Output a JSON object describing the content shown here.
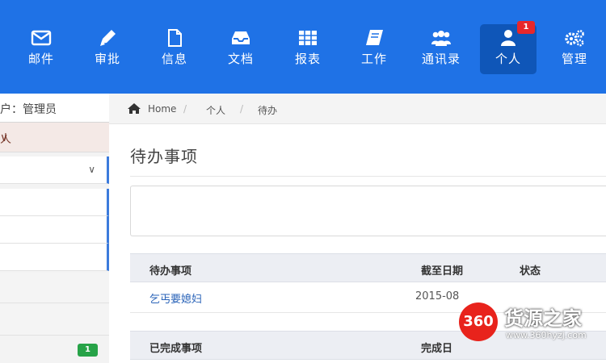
{
  "nav": {
    "items": [
      {
        "label": "邮件",
        "icon": "envelope-icon"
      },
      {
        "label": "审批",
        "icon": "pencil-icon"
      },
      {
        "label": "信息",
        "icon": "file-icon"
      },
      {
        "label": "文档",
        "icon": "inbox-icon"
      },
      {
        "label": "报表",
        "icon": "table-icon"
      },
      {
        "label": "工作",
        "icon": "book-icon"
      },
      {
        "label": "通讯录",
        "icon": "users-icon"
      },
      {
        "label": "个人",
        "icon": "user-icon",
        "active": true,
        "badge": "1"
      },
      {
        "label": "管理",
        "icon": "cogs-icon"
      }
    ]
  },
  "sidebar": {
    "user_label": "户：管理员",
    "menu_label": "人",
    "badge": "1"
  },
  "breadcrumb": {
    "home": "Home",
    "personal": "个人",
    "current": "待办"
  },
  "page": {
    "title": "待办事项"
  },
  "todo_table": {
    "headers": [
      "待办事项",
      "截至日期",
      "状态"
    ],
    "rows": [
      {
        "item": "乞丐要媳妇",
        "date": "2015-08"
      }
    ]
  },
  "done_table": {
    "headers": [
      "已完成事项",
      "完成日"
    ]
  },
  "watermark": {
    "logo": "360",
    "name": "货源之家",
    "url": "www.360hyzj.com"
  },
  "colors": {
    "nav_bg": "#1f72e6",
    "nav_active": "#0f56b8",
    "badge_red": "#e8272a",
    "badge_green": "#27a348",
    "link": "#2a63b8"
  }
}
